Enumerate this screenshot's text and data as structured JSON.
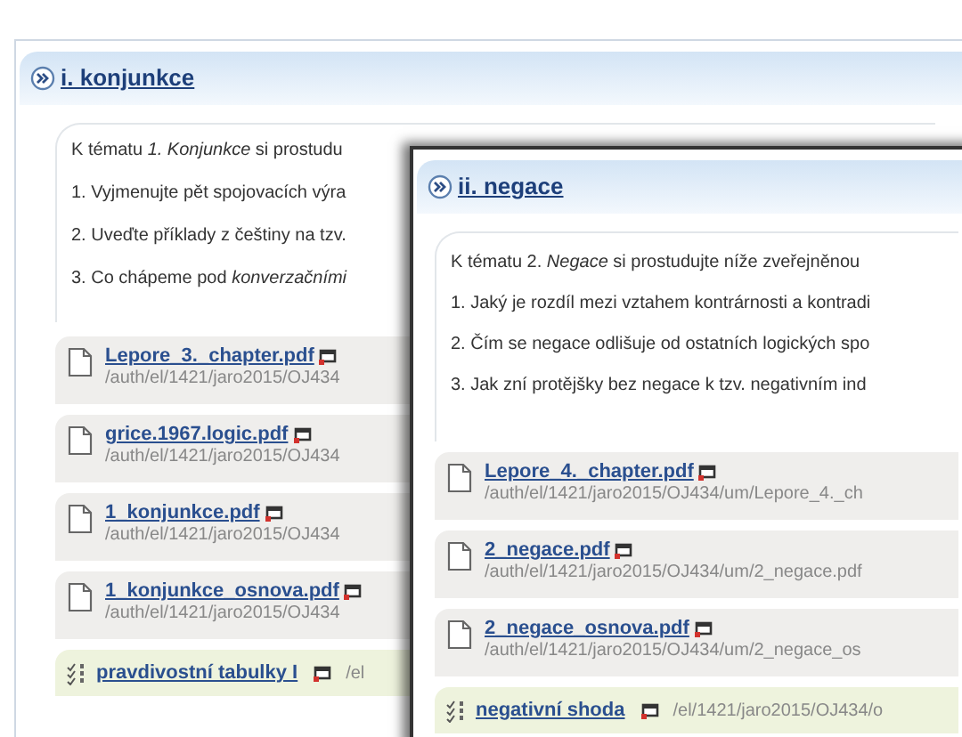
{
  "panels": [
    {
      "title": "i. konjunkce",
      "intro": [
        "K tématu *1. Konjunkce* si prostudu",
        "1. Vyjmenujte pět spojovacích výra",
        "2. Uveďte příklady z češtiny na tzv.",
        "3. Co chápeme pod *konverzačními*"
      ],
      "items": [
        {
          "kind": "file",
          "name": "Lepore_3._chapter.pdf",
          "path": "/auth/el/1421/jaro2015/OJ434"
        },
        {
          "kind": "file",
          "name": "grice.1967.logic.pdf",
          "path": "/auth/el/1421/jaro2015/OJ434"
        },
        {
          "kind": "file",
          "name": "1_konjunkce.pdf",
          "path": "/auth/el/1421/jaro2015/OJ434"
        },
        {
          "kind": "file",
          "name": "1_konjunkce_osnova.pdf",
          "path": "/auth/el/1421/jaro2015/OJ434"
        },
        {
          "kind": "quiz",
          "name": "pravdivostní tabulky I",
          "path": "/el"
        }
      ]
    },
    {
      "title": "ii. negace",
      "intro": [
        "K tématu 2. *Negace* si prostudujte níže zveřejněnou",
        "1. Jaký je rozdíl mezi vztahem kontrárnosti a kontradi",
        "2. Čím se negace odlišuje od ostatních logických spo",
        "3. Jak zní protějšky bez negace k tzv. negativním ind"
      ],
      "items": [
        {
          "kind": "file",
          "name": "Lepore_4._chapter.pdf",
          "path": "/auth/el/1421/jaro2015/OJ434/um/Lepore_4._ch"
        },
        {
          "kind": "file",
          "name": "2_negace.pdf",
          "path": "/auth/el/1421/jaro2015/OJ434/um/2_negace.pdf"
        },
        {
          "kind": "file",
          "name": "2_negace_osnova.pdf",
          "path": "/auth/el/1421/jaro2015/OJ434/um/2_negace_os"
        },
        {
          "kind": "quiz",
          "name": "negativní shoda",
          "path": "/el/1421/jaro2015/OJ434/o"
        }
      ]
    }
  ]
}
